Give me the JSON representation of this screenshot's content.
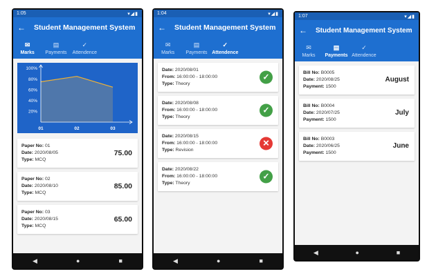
{
  "phones": [
    {
      "status_time": "1:05",
      "title": "Student Management System",
      "tabs": [
        {
          "label": "Marks",
          "icon": "mail-icon"
        },
        {
          "label": "Payments",
          "icon": "payments-icon"
        },
        {
          "label": "Attendence",
          "icon": "check-icon"
        }
      ],
      "active_tab": 0,
      "chart_data": {
        "type": "area",
        "categories": [
          "01",
          "02",
          "03"
        ],
        "values": [
          75,
          85,
          65
        ],
        "ylim": [
          0,
          100
        ],
        "yticks": [
          "20%",
          "40%",
          "60%",
          "80%",
          "100%"
        ],
        "colors": {
          "fill": "#4f77ab",
          "line": "#f2b233",
          "axis": "#ffffff",
          "background": "#1f64c8"
        }
      },
      "marks": [
        {
          "paper_label": "Paper No:",
          "paper": "01",
          "date_label": "Date:",
          "date": "2020/08/05",
          "type_label": "Type:",
          "type": "MCQ",
          "score": "75.00"
        },
        {
          "paper_label": "Paper No:",
          "paper": "02",
          "date_label": "Date:",
          "date": "2020/08/10",
          "type_label": "Type:",
          "type": "MCQ",
          "score": "85.00"
        },
        {
          "paper_label": "Paper No:",
          "paper": "03",
          "date_label": "Date:",
          "date": "2020/08/15",
          "type_label": "Type:",
          "type": "MCQ",
          "score": "65.00"
        }
      ]
    },
    {
      "status_time": "1:04",
      "title": "Student Management System",
      "tabs": [
        {
          "label": "Marks",
          "icon": "mail-icon"
        },
        {
          "label": "Payments",
          "icon": "payments-icon"
        },
        {
          "label": "Attendence",
          "icon": "check-icon"
        }
      ],
      "active_tab": 2,
      "attendance": [
        {
          "date_label": "Date:",
          "date": "2020/08/01",
          "from_label": "From:",
          "from": "16:00:00 - 18:00:00",
          "type_label": "Type:",
          "type": "Theory",
          "status": "present"
        },
        {
          "date_label": "Date:",
          "date": "2020/08/08",
          "from_label": "From:",
          "from": "16:00:00 - 18:00:00",
          "type_label": "Type:",
          "type": "Theory",
          "status": "present"
        },
        {
          "date_label": "Date:",
          "date": "2020/08/15",
          "from_label": "From:",
          "from": "16:00:00 - 18:00:00",
          "type_label": "Type:",
          "type": "Revision",
          "status": "absent"
        },
        {
          "date_label": "Date:",
          "date": "2020/08/22",
          "from_label": "From:",
          "from": "16:00:00 - 18:00:00",
          "type_label": "Type:",
          "type": "Theory",
          "status": "present"
        }
      ]
    },
    {
      "status_time": "1:07",
      "title": "Student Management System",
      "tabs": [
        {
          "label": "Marks",
          "icon": "mail-icon"
        },
        {
          "label": "Payments",
          "icon": "payments-icon"
        },
        {
          "label": "Attendence",
          "icon": "check-icon"
        }
      ],
      "active_tab": 1,
      "payments": [
        {
          "bill_label": "Bill No:",
          "bill": "B0005",
          "date_label": "Date:",
          "date": "2020/08/25",
          "payment_label": "Payment:",
          "payment": "1500",
          "month": "August"
        },
        {
          "bill_label": "Bill No:",
          "bill": "B0004",
          "date_label": "Date:",
          "date": "2020/07/25",
          "payment_label": "Payment:",
          "payment": "1500",
          "month": "July"
        },
        {
          "bill_label": "Bill No:",
          "bill": "B0003",
          "date_label": "Date:",
          "date": "2020/06/25",
          "payment_label": "Payment:",
          "payment": "1500",
          "month": "June"
        }
      ]
    }
  ]
}
